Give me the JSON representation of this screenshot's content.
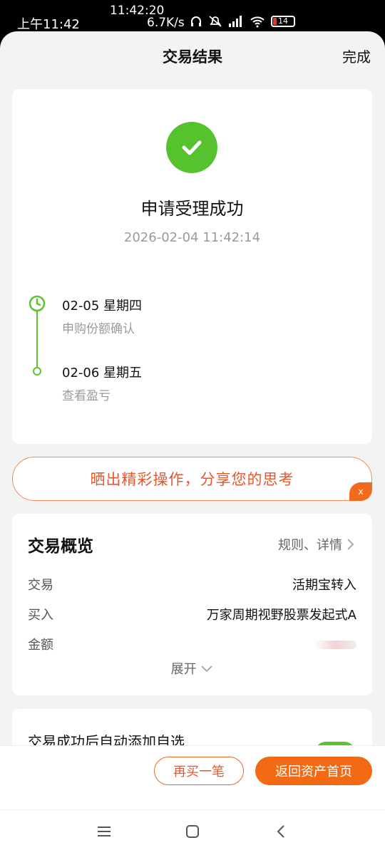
{
  "status_bar": {
    "time_left": "上午11:42",
    "time_top": "11:42:20",
    "net_speed": "6.7K/s",
    "battery_level": "14",
    "icons": [
      "headphones-icon",
      "mute-icon",
      "signal-icon",
      "wifi-icon",
      "battery-icon"
    ]
  },
  "nav": {
    "title": "交易结果",
    "done_label": "完成"
  },
  "result": {
    "title": "申请受理成功",
    "timestamp": "2026-02-04 11:42:14",
    "timeline": [
      {
        "date": "02-05  星期四",
        "desc": "申购份额确认"
      },
      {
        "date": "02-06  星期五",
        "desc": "查看盈亏"
      }
    ]
  },
  "share_banner": {
    "text": "晒出精彩操作，分享您的思考",
    "close_label": "x"
  },
  "overview": {
    "title": "交易概览",
    "rules_label": "规则、详情",
    "rows": [
      {
        "label": "交易",
        "value": "活期宝转入"
      },
      {
        "label": "买入",
        "value": "万家周期视野股票发起式A"
      },
      {
        "label": "金额",
        "value": ""
      }
    ],
    "expand_label": "展开"
  },
  "auto_add": {
    "label": "交易成功后自动添加自选",
    "enabled": true
  },
  "actions": {
    "rebuy_label": "再买一笔",
    "home_label": "返回资产首页"
  },
  "colors": {
    "accent": "#f36a14",
    "success": "#55c22e",
    "page_bg": "#f3f3f3"
  }
}
